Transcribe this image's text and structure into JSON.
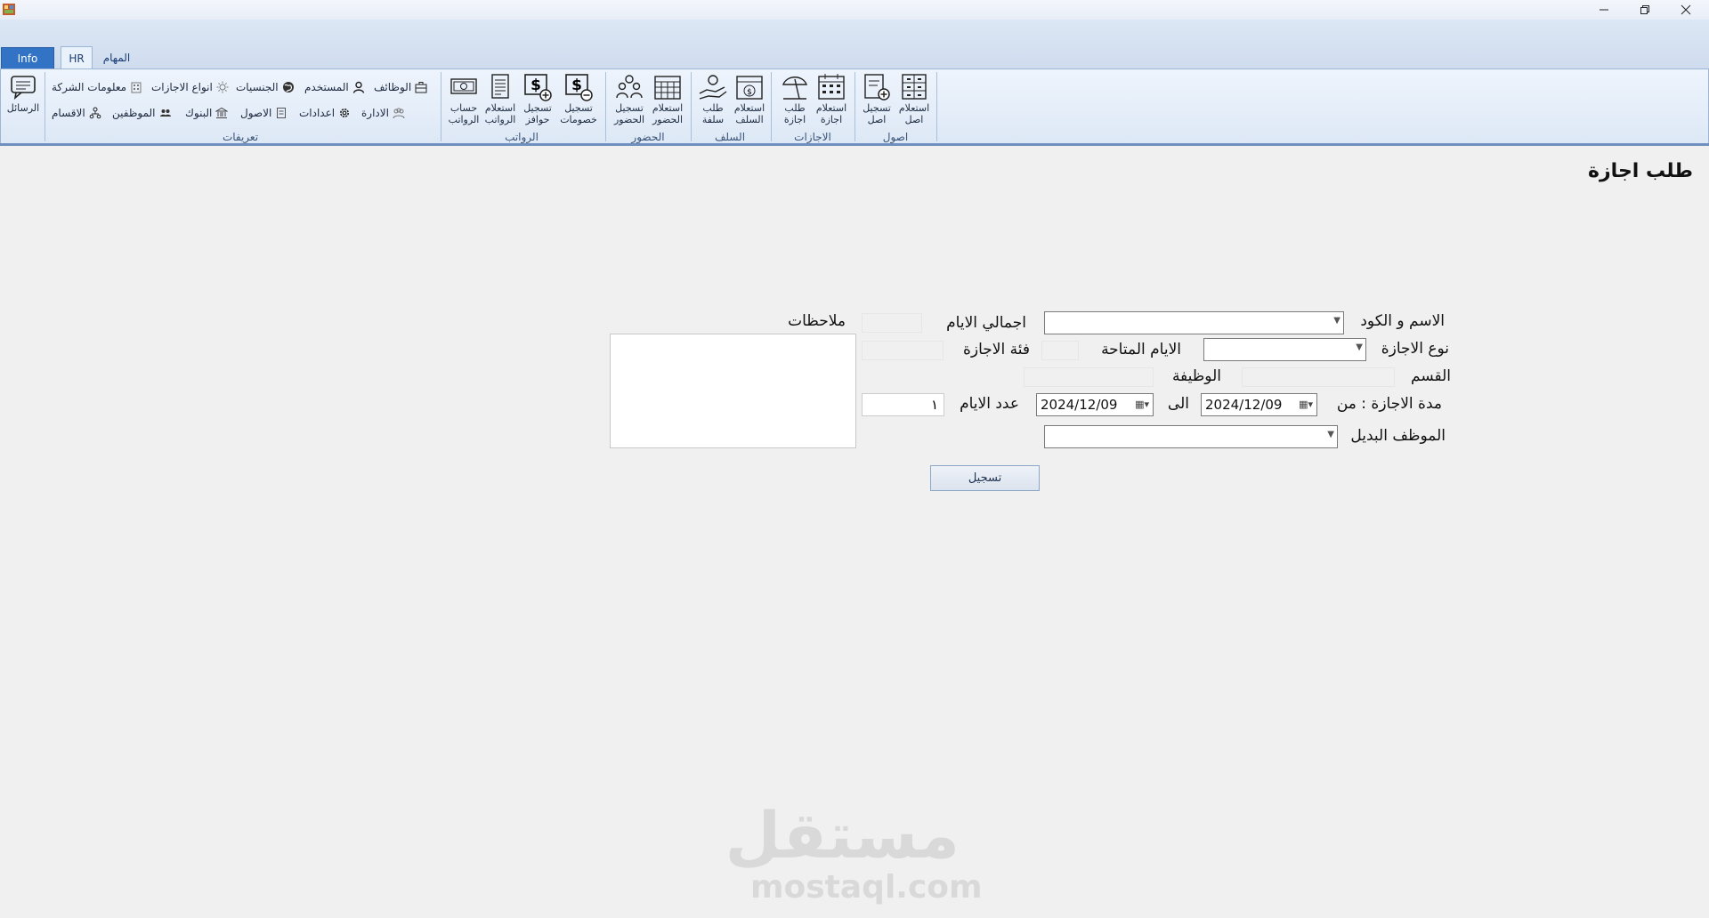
{
  "window": {
    "minimize_icon": "minimize-icon",
    "restore_icon": "restore-icon",
    "close_icon": "close-icon"
  },
  "tabs": {
    "info": "Info",
    "hr": "HR",
    "tasks": "المهام"
  },
  "ribbon": {
    "messages": "الرسائل",
    "definitions": {
      "label": "تعريفات",
      "items_row1": [
        "الوظائف",
        "المستخدم",
        "الجنسيات",
        "انواع الاجازات",
        "معلومات الشركة"
      ],
      "items_row2": [
        "الادارة",
        "اعدادات",
        "الاصول",
        "البنوك",
        "الموظفين",
        "الاقسام"
      ]
    },
    "salaries": {
      "label": "الرواتب",
      "deductions": "تسجيل\nخصومات",
      "incentives": "تسجيل\nحوافز",
      "inquiry": "استعلام\nالرواتب",
      "calc": "حساب\nالرواتب"
    },
    "attendance": {
      "label": "الحضور",
      "inquiry": "استعلام\nالحضور",
      "register": "تسجيل\nالحضور"
    },
    "advances": {
      "label": "السلف",
      "inquiry": "استعلام\nالسلف",
      "request": "طلب\nسلفة"
    },
    "leaves": {
      "label": "الاجازات",
      "inquiry": "استعلام\nاجازة",
      "request": "طلب\nاجازة"
    },
    "assets": {
      "label": "اصول",
      "inquiry": "استعلام\nاصل",
      "register": "تسجيل\nاصل"
    }
  },
  "form": {
    "title": "طلب اجازة",
    "name_code_label": "الاسم و الكود",
    "total_days_label": "اجمالي الايام",
    "notes_label": "ملاحظات",
    "leave_type_label": "نوع الاجازة",
    "available_days_label": "الايام المتاحة",
    "leave_category_label": "فئة الاجازة",
    "department_label": "القسم",
    "job_label": "الوظيفة",
    "period_from_label": "مدة الاجازة : من",
    "from_date": "2024/12/09",
    "to_label": "الى",
    "to_date": "2024/12/09",
    "days_count_label": "عدد الايام",
    "days_count_value": "١",
    "substitute_label": "الموظف البديل",
    "submit_label": "تسجيل"
  },
  "watermark": {
    "arabic": "مستقل",
    "english": "mostaql.com"
  }
}
